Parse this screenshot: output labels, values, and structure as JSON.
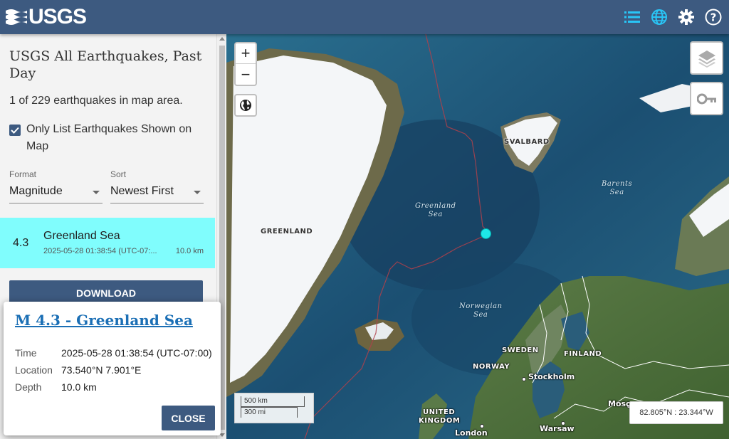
{
  "header": {
    "logo_text": "USGS",
    "icons": [
      "list-icon",
      "globe-icon",
      "gear-icon",
      "help-icon"
    ]
  },
  "sidebar": {
    "title": "USGS All Earthquakes, Past Day",
    "count_text": "1 of 229 earthquakes in map area.",
    "only_list_label": "Only List Earthquakes Shown on Map",
    "only_list_checked": true,
    "format_label": "Format",
    "format_value": "Magnitude",
    "sort_label": "Sort",
    "sort_value": "Newest First",
    "download_label": "DOWNLOAD"
  },
  "earthquake": {
    "magnitude": "4.3",
    "place": "Greenland Sea",
    "time": "2025-05-28 01:38:54 (UTC-07:...",
    "depth": "10.0 km"
  },
  "popup": {
    "title": "M 4.3 - Greenland Sea",
    "time_label": "Time",
    "time_value": "2025-05-28 01:38:54 (UTC-07:00)",
    "location_label": "Location",
    "location_value": "73.540°N 7.901°E",
    "depth_label": "Depth",
    "depth_value": "10.0 km",
    "close_label": "CLOSE"
  },
  "map": {
    "zoom_in": "+",
    "zoom_out": "−",
    "labels": {
      "greenland": "GREENLAND",
      "svalbard": "SVALBARD",
      "sweden": "SWEDEN",
      "finland": "FINLAND",
      "norway": "NORWAY",
      "united_kingdom_1": "UNITED",
      "united_kingdom_2": "KINGDOM"
    },
    "seas": {
      "greenland_sea_1": "Greenland",
      "greenland_sea_2": "Sea",
      "barents_sea_1": "Barents",
      "barents_sea_2": "Sea",
      "norwegian_sea_1": "Norwegian",
      "norwegian_sea_2": "Sea"
    },
    "cities": {
      "stockholm": "Stockholm",
      "warsaw": "Warsaw",
      "london": "London",
      "moscow": "Mosc"
    },
    "scale_km": "500 km",
    "scale_mi": "300 mi",
    "coordinates": "82.805°N : 23.344°W"
  },
  "colors": {
    "header_bg": "#3d5a80",
    "selected_row": "#80fdfd",
    "quake_marker": "#1ee8e8",
    "accent_icon": "#29c5f6"
  }
}
